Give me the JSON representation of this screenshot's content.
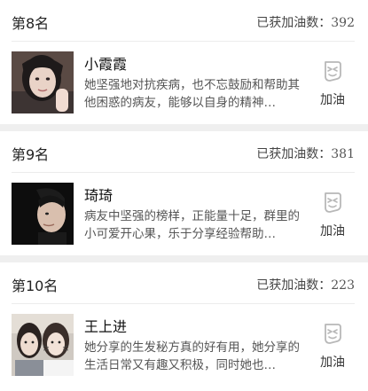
{
  "cards": [
    {
      "rank": "第8名",
      "cheer_prefix": "已获加油数：",
      "cheer_count": "392",
      "name": "小霞霞",
      "description": "她坚强地对抗疾病，也不忘鼓励和帮助其他困惑的病友，能够以自身的精神…",
      "button_label": "加油",
      "button_icon": "cheer-face-icon"
    },
    {
      "rank": "第9名",
      "cheer_prefix": "已获加油数：",
      "cheer_count": "381",
      "name": "琦琦",
      "description": "病友中坚强的榜样，正能量十足，群里的小可爱开心果，乐于分享经验帮助…",
      "button_label": "加油",
      "button_icon": "cheer-face-icon"
    },
    {
      "rank": "第10名",
      "cheer_prefix": "已获加油数：",
      "cheer_count": "223",
      "name": "王上进",
      "description": "她分享的生发秘方真的好有用，她分享的生活日常又有趣又积极，同时她也…",
      "button_label": "加油",
      "button_icon": "cheer-face-icon"
    }
  ],
  "colors": {
    "page_background": "#efefef",
    "card_background": "#ffffff",
    "divider": "#ececec",
    "icon_stroke": "#b8b8b8"
  }
}
